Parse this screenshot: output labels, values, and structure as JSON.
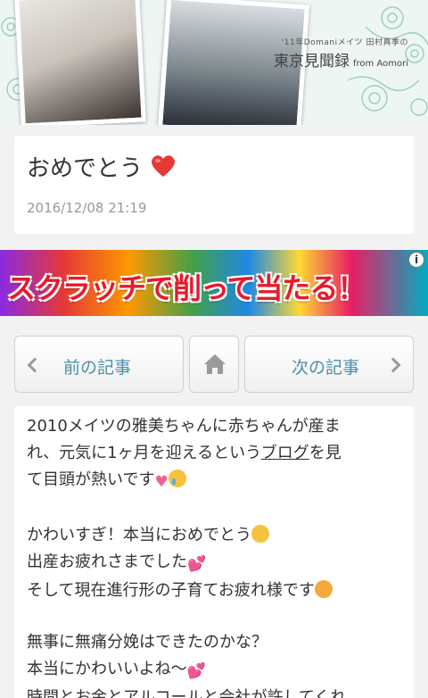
{
  "header": {
    "subtitle": "'11年Domaniメイツ 田村真季の",
    "title": "東京見聞録",
    "title_suffix": "from Aomori"
  },
  "post": {
    "title": "おめでとう",
    "title_emoji": "heart-icon",
    "date": "2016/12/08 21:19"
  },
  "ad": {
    "text": "スクラッチで削って当たる！",
    "info_label": "i"
  },
  "nav": {
    "prev_label": "前の記事",
    "next_label": "次の記事",
    "home_icon": "home-icon"
  },
  "body": {
    "line1": "2010メイツの雅美ちゃんに赤ちゃんが産ま",
    "line2_before": "れ、元気に1ヶ月を迎えるという",
    "line2_link": "ブログ",
    "line2_after": "を見",
    "line3": "て目頭が熱いです",
    "line4": "かわいすぎ！本当におめでとう",
    "line5": "出産お疲れさまでした",
    "line6": "そして現在進行形の子育てお疲れ様です",
    "line7": "無事に無痛分娩はできたのかな？",
    "line8": "本当にかわいいよね〜",
    "line9": "時間とお金とアルコールと会社が許してくれ"
  },
  "colors": {
    "accent_link": "#4a90a8",
    "ad_text": "#e8192c",
    "heart": "#e53935"
  }
}
